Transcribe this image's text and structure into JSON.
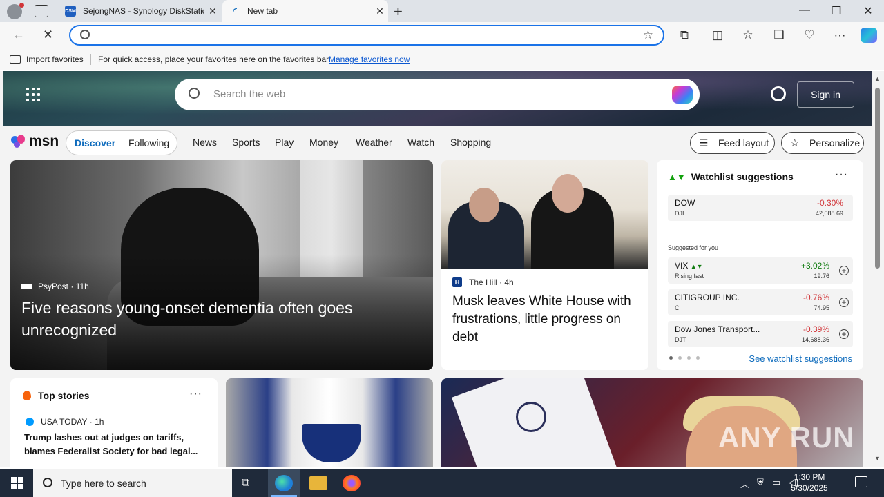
{
  "browser": {
    "tabs": [
      {
        "title": "SejongNAS - Synology DiskStatio",
        "favicon": "DSM",
        "active": false
      },
      {
        "title": "New tab",
        "active": true
      }
    ],
    "address_placeholder": "",
    "favorites_bar": {
      "import_label": "Import favorites",
      "message": "For quick access, place your favorites here on the favorites bar.",
      "link": "Manage favorites now"
    }
  },
  "msn": {
    "search_placeholder": "Search the web",
    "signin_label": "Sign in",
    "logo_text": "msn",
    "pills": [
      "Discover",
      "Following"
    ],
    "nav_links": [
      "News",
      "Sports",
      "Play",
      "Money",
      "Weather",
      "Watch",
      "Shopping"
    ],
    "feed_layout_label": "Feed layout",
    "personalize_label": "Personalize"
  },
  "hero": {
    "source": "PsyPost",
    "age": "11h",
    "headline": "Five reasons young-onset dementia often goes unrecognized"
  },
  "news2": {
    "source": "The Hill",
    "age": "4h",
    "headline": "Musk leaves White House with frustrations, little progress on debt"
  },
  "watchlist": {
    "title": "Watchlist suggestions",
    "more": "···",
    "dow": {
      "name": "DOW",
      "ticker": "DJI",
      "change": "-0.30%",
      "price": "42,088.69"
    },
    "suggested_label": "Suggested for you",
    "suggestions": [
      {
        "name": "VIX",
        "ticker": "Rising fast",
        "change": "+3.02%",
        "price": "19.76",
        "dir": "pos"
      },
      {
        "name": "CITIGROUP INC.",
        "ticker": "C",
        "change": "-0.76%",
        "price": "74.95",
        "dir": "neg"
      },
      {
        "name": "Dow Jones Transport...",
        "ticker": "DJT",
        "change": "-0.39%",
        "price": "14,688.36",
        "dir": "neg"
      }
    ],
    "see_all": "See watchlist suggestions"
  },
  "top_stories": {
    "title": "Top stories",
    "more": "···",
    "source": "USA TODAY",
    "age": "1h",
    "headline": "Trump lashes out at judges on tariffs, blames Federalist Society for bad legal..."
  },
  "watermark": "ANY RUN",
  "taskbar": {
    "search_placeholder": "Type here to search",
    "time": "1:30 PM",
    "date": "5/30/2025"
  },
  "colors": {
    "accent": "#0f6cbd",
    "positive": "#107c10",
    "negative": "#d13438"
  }
}
